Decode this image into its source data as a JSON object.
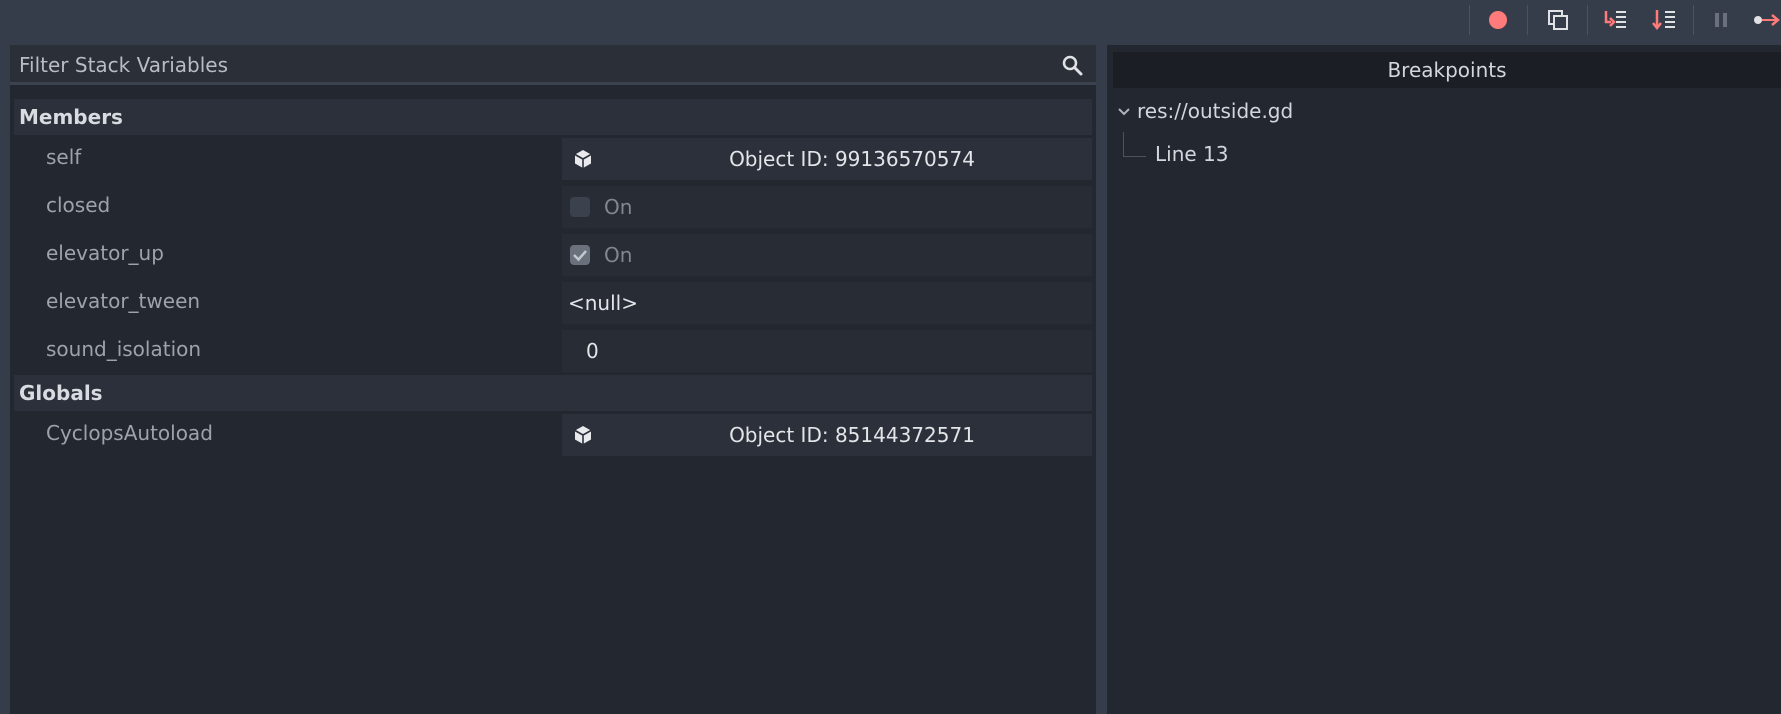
{
  "toolbar": {
    "buttons": [
      "record-icon",
      "copy-icon",
      "step-into-icon",
      "step-over-icon",
      "pause-icon",
      "continue-icon"
    ],
    "accent_color": "#ff7a7a"
  },
  "filter": {
    "placeholder": "Filter Stack Variables"
  },
  "members": {
    "title": "Members",
    "self": {
      "name": "self",
      "value": "Object ID: 99136570574"
    },
    "closed": {
      "name": "closed",
      "value": "On",
      "checked": false
    },
    "elevator_up": {
      "name": "elevator_up",
      "value": "On",
      "checked": true
    },
    "elevator_tween": {
      "name": "elevator_tween",
      "value": "<null>"
    },
    "sound_isolation": {
      "name": "sound_isolation",
      "value": "0"
    }
  },
  "globals": {
    "title": "Globals",
    "cyclops": {
      "name": "CyclopsAutoload",
      "value": "Object ID: 85144372571"
    }
  },
  "breakpoints": {
    "title": "Breakpoints",
    "file": "res://outside.gd",
    "line": "Line 13"
  }
}
